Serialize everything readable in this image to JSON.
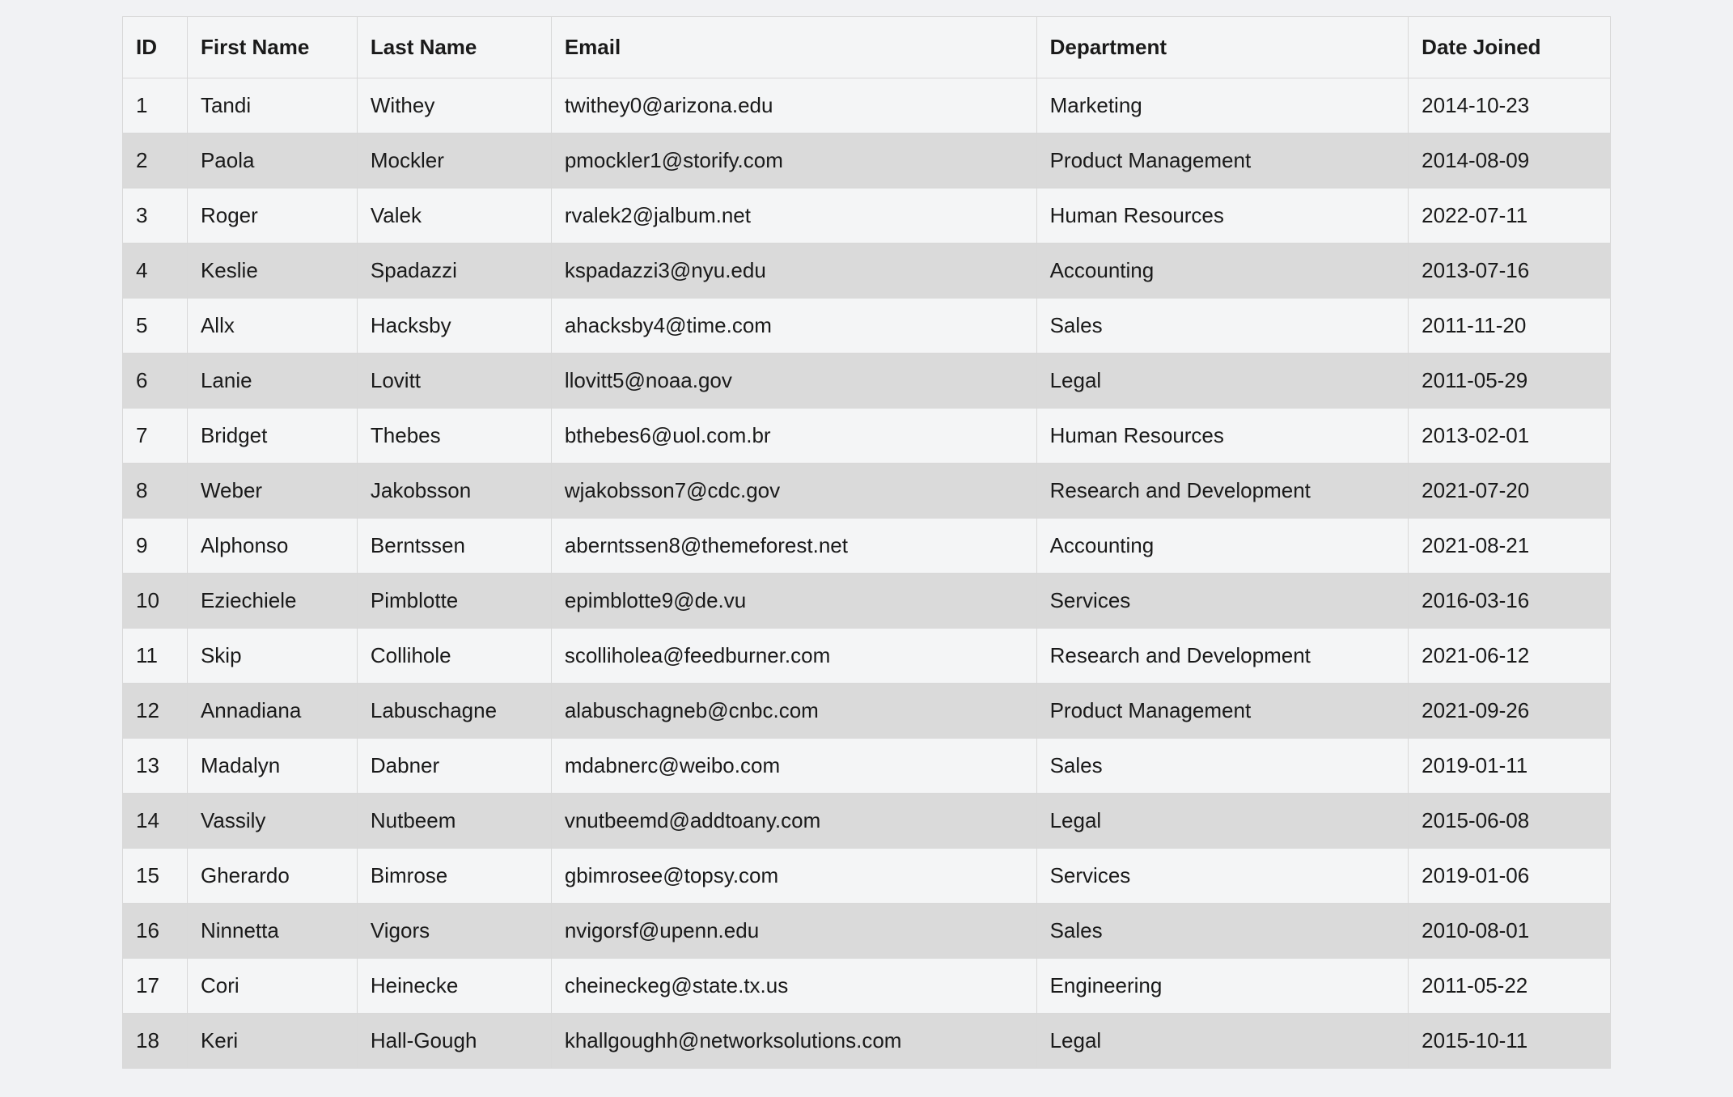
{
  "table": {
    "headers": {
      "id": "ID",
      "first_name": "First Name",
      "last_name": "Last Name",
      "email": "Email",
      "department": "Department",
      "date_joined": "Date Joined"
    },
    "rows": [
      {
        "id": "1",
        "first_name": "Tandi",
        "last_name": "Withey",
        "email": "twithey0@arizona.edu",
        "department": "Marketing",
        "date_joined": "2014-10-23"
      },
      {
        "id": "2",
        "first_name": "Paola",
        "last_name": "Mockler",
        "email": "pmockler1@storify.com",
        "department": "Product Management",
        "date_joined": "2014-08-09"
      },
      {
        "id": "3",
        "first_name": "Roger",
        "last_name": "Valek",
        "email": "rvalek2@jalbum.net",
        "department": "Human Resources",
        "date_joined": "2022-07-11"
      },
      {
        "id": "4",
        "first_name": "Keslie",
        "last_name": "Spadazzi",
        "email": "kspadazzi3@nyu.edu",
        "department": "Accounting",
        "date_joined": "2013-07-16"
      },
      {
        "id": "5",
        "first_name": "Allx",
        "last_name": "Hacksby",
        "email": "ahacksby4@time.com",
        "department": "Sales",
        "date_joined": "2011-11-20"
      },
      {
        "id": "6",
        "first_name": "Lanie",
        "last_name": "Lovitt",
        "email": "llovitt5@noaa.gov",
        "department": "Legal",
        "date_joined": "2011-05-29"
      },
      {
        "id": "7",
        "first_name": "Bridget",
        "last_name": "Thebes",
        "email": "bthebes6@uol.com.br",
        "department": "Human Resources",
        "date_joined": "2013-02-01"
      },
      {
        "id": "8",
        "first_name": "Weber",
        "last_name": "Jakobsson",
        "email": "wjakobsson7@cdc.gov",
        "department": "Research and Development",
        "date_joined": "2021-07-20"
      },
      {
        "id": "9",
        "first_name": "Alphonso",
        "last_name": "Berntssen",
        "email": "aberntssen8@themeforest.net",
        "department": "Accounting",
        "date_joined": "2021-08-21"
      },
      {
        "id": "10",
        "first_name": "Eziechiele",
        "last_name": "Pimblotte",
        "email": "epimblotte9@de.vu",
        "department": "Services",
        "date_joined": "2016-03-16"
      },
      {
        "id": "11",
        "first_name": "Skip",
        "last_name": "Collihole",
        "email": "scolliholea@feedburner.com",
        "department": "Research and Development",
        "date_joined": "2021-06-12"
      },
      {
        "id": "12",
        "first_name": "Annadiana",
        "last_name": "Labuschagne",
        "email": "alabuschagneb@cnbc.com",
        "department": "Product Management",
        "date_joined": "2021-09-26"
      },
      {
        "id": "13",
        "first_name": "Madalyn",
        "last_name": "Dabner",
        "email": "mdabnerc@weibo.com",
        "department": "Sales",
        "date_joined": "2019-01-11"
      },
      {
        "id": "14",
        "first_name": "Vassily",
        "last_name": "Nutbeem",
        "email": "vnutbeemd@addtoany.com",
        "department": "Legal",
        "date_joined": "2015-06-08"
      },
      {
        "id": "15",
        "first_name": "Gherardo",
        "last_name": "Bimrose",
        "email": "gbimrosee@topsy.com",
        "department": "Services",
        "date_joined": "2019-01-06"
      },
      {
        "id": "16",
        "first_name": "Ninnetta",
        "last_name": "Vigors",
        "email": "nvigorsf@upenn.edu",
        "department": "Sales",
        "date_joined": "2010-08-01"
      },
      {
        "id": "17",
        "first_name": "Cori",
        "last_name": "Heinecke",
        "email": "cheineckeg@state.tx.us",
        "department": "Engineering",
        "date_joined": "2011-05-22"
      },
      {
        "id": "18",
        "first_name": "Keri",
        "last_name": "Hall-Gough",
        "email": "khallgoughh@networksolutions.com",
        "department": "Legal",
        "date_joined": "2015-10-11"
      }
    ]
  }
}
